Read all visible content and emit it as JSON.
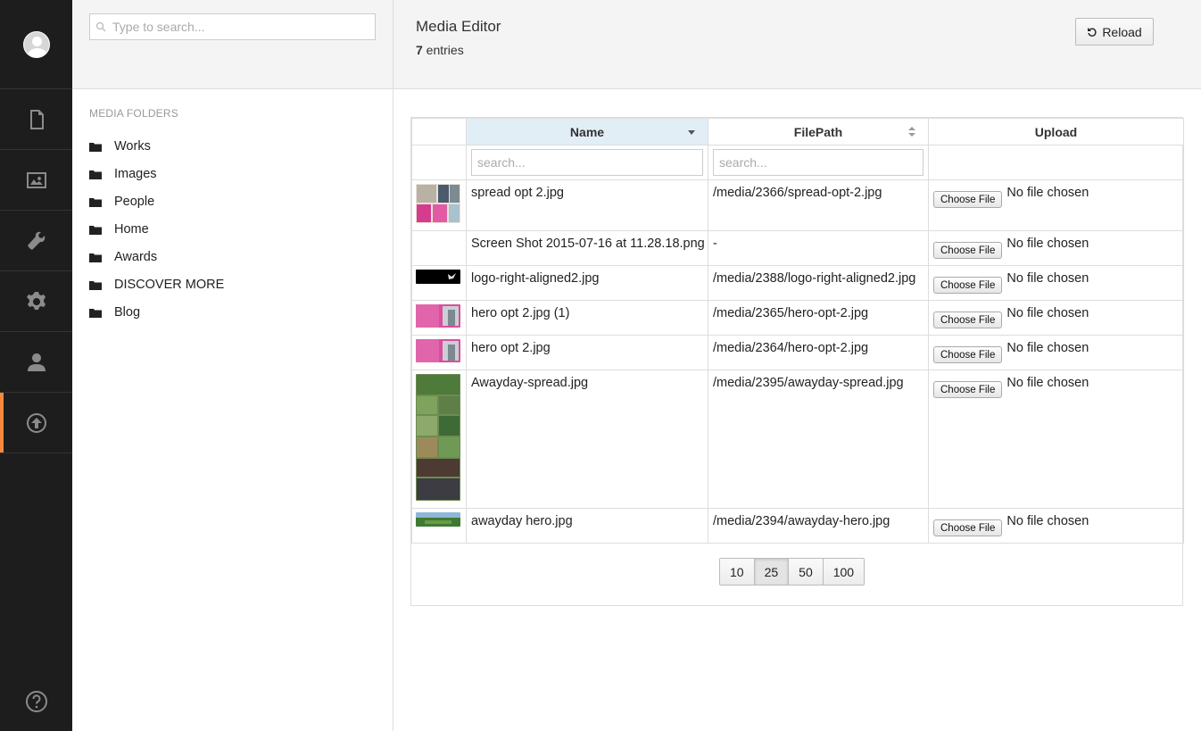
{
  "nav": {
    "items": [
      {
        "name": "content-icon"
      },
      {
        "name": "media-icon"
      },
      {
        "name": "developer-icon"
      },
      {
        "name": "settings-icon"
      },
      {
        "name": "users-icon"
      },
      {
        "name": "deploy-icon",
        "active": true
      }
    ],
    "help_icon": "help-icon"
  },
  "tree": {
    "search_placeholder": "Type to search...",
    "section_title": "MEDIA FOLDERS",
    "folders": [
      "Works",
      "Images",
      "People",
      "Home",
      "Awards",
      "DISCOVER MORE",
      "Blog"
    ]
  },
  "header": {
    "title": "Media Editor",
    "entries_count": "7",
    "entries_label": " entries",
    "reload_label": "Reload"
  },
  "grid": {
    "columns": {
      "name": "Name",
      "filepath": "FilePath",
      "upload": "Upload"
    },
    "filter_placeholder": "search...",
    "choose_file_label": "Choose File",
    "no_file_label": "No file chosen",
    "rows": [
      {
        "name": "spread opt 2.jpg",
        "path": "/media/2366/spread-opt-2.jpg",
        "thumb": "collage"
      },
      {
        "name": "Screen Shot 2015-07-16 at 11.28.18.png",
        "path": "-",
        "thumb": "none"
      },
      {
        "name": "logo-right-aligned2.jpg",
        "path": "/media/2388/logo-right-aligned2.jpg",
        "thumb": "logo"
      },
      {
        "name": "hero opt 2.jpg (1)",
        "path": "/media/2365/hero-opt-2.jpg",
        "thumb": "hero"
      },
      {
        "name": "hero opt 2.jpg",
        "path": "/media/2364/hero-opt-2.jpg",
        "thumb": "hero"
      },
      {
        "name": "Awayday-spread.jpg",
        "path": "/media/2395/awayday-spread.jpg",
        "thumb": "spread"
      },
      {
        "name": "awayday hero.jpg",
        "path": "/media/2394/awayday-hero.jpg",
        "thumb": "park"
      }
    ],
    "page_sizes": [
      "10",
      "25",
      "50",
      "100"
    ],
    "active_page_size": "25"
  }
}
